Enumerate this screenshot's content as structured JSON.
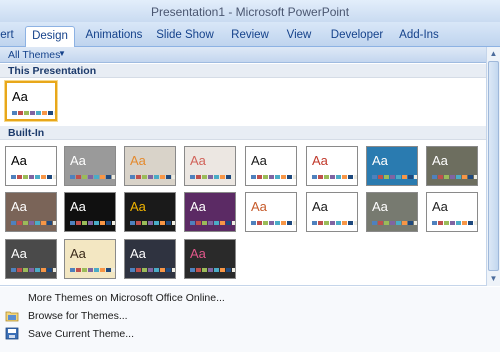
{
  "window": {
    "title": "Presentation1 - Microsoft PowerPoint"
  },
  "ribbon": {
    "tabs": [
      {
        "label": "ert",
        "active": false
      },
      {
        "label": "Design",
        "active": true
      },
      {
        "label": "Animations",
        "active": false
      },
      {
        "label": "Slide Show",
        "active": false
      },
      {
        "label": "Review",
        "active": false
      },
      {
        "label": "View",
        "active": false
      },
      {
        "label": "Developer",
        "active": false
      },
      {
        "label": "Add-Ins",
        "active": false
      }
    ]
  },
  "gallery": {
    "filter_label": "All Themes",
    "section_this": "This Presentation",
    "section_builtin": "Built-In",
    "thumb_text": "Aa",
    "this_presentation": [
      {
        "theme": "office",
        "bg": "#ffffff",
        "fg": "#000000",
        "selected": true
      }
    ],
    "builtin": [
      {
        "theme": "office",
        "bg": "#ffffff",
        "fg": "#000000"
      },
      {
        "theme": "apex",
        "bg": "#9a9a9a",
        "fg": "#ffffff"
      },
      {
        "theme": "aspect",
        "bg": "#d9d3c9",
        "fg": "#e48a2e"
      },
      {
        "theme": "civic",
        "bg": "#ece7e2",
        "fg": "#d1635a"
      },
      {
        "theme": "concourse",
        "bg": "#ffffff",
        "fg": "#1a1a1a"
      },
      {
        "theme": "equity",
        "bg": "#ffffff",
        "fg": "#c0392b"
      },
      {
        "theme": "flow",
        "bg": "#2a7bb0",
        "fg": "#ffffff"
      },
      {
        "theme": "foundry",
        "bg": "#6d6e5f",
        "fg": "#ffffff"
      },
      {
        "theme": "median",
        "bg": "#7a6458",
        "fg": "#ffffff"
      },
      {
        "theme": "metro",
        "bg": "#101010",
        "fg": "#ffffff"
      },
      {
        "theme": "module",
        "bg": "#1a1a1a",
        "fg": "#f0b400"
      },
      {
        "theme": "opulent",
        "bg": "#5b2a64",
        "fg": "#ffffff"
      },
      {
        "theme": "oriel",
        "bg": "#ffffff",
        "fg": "#c65a2a"
      },
      {
        "theme": "origin",
        "bg": "#ffffff",
        "fg": "#1a1a1a"
      },
      {
        "theme": "paper",
        "bg": "#777a70",
        "fg": "#ffffff"
      },
      {
        "theme": "solstice",
        "bg": "#ffffff",
        "fg": "#222222"
      },
      {
        "theme": "technic",
        "bg": "#4a4a4a",
        "fg": "#ffffff"
      },
      {
        "theme": "trek",
        "bg": "#f3e7c2",
        "fg": "#3a2a1a"
      },
      {
        "theme": "urban",
        "bg": "#2f3340",
        "fg": "#ffffff"
      },
      {
        "theme": "verve",
        "bg": "#2a2a2a",
        "fg": "#e2578b"
      }
    ]
  },
  "menu": {
    "more_themes": "More Themes on Microsoft Office Online...",
    "browse": "Browse for Themes...",
    "save": "Save Current Theme..."
  }
}
